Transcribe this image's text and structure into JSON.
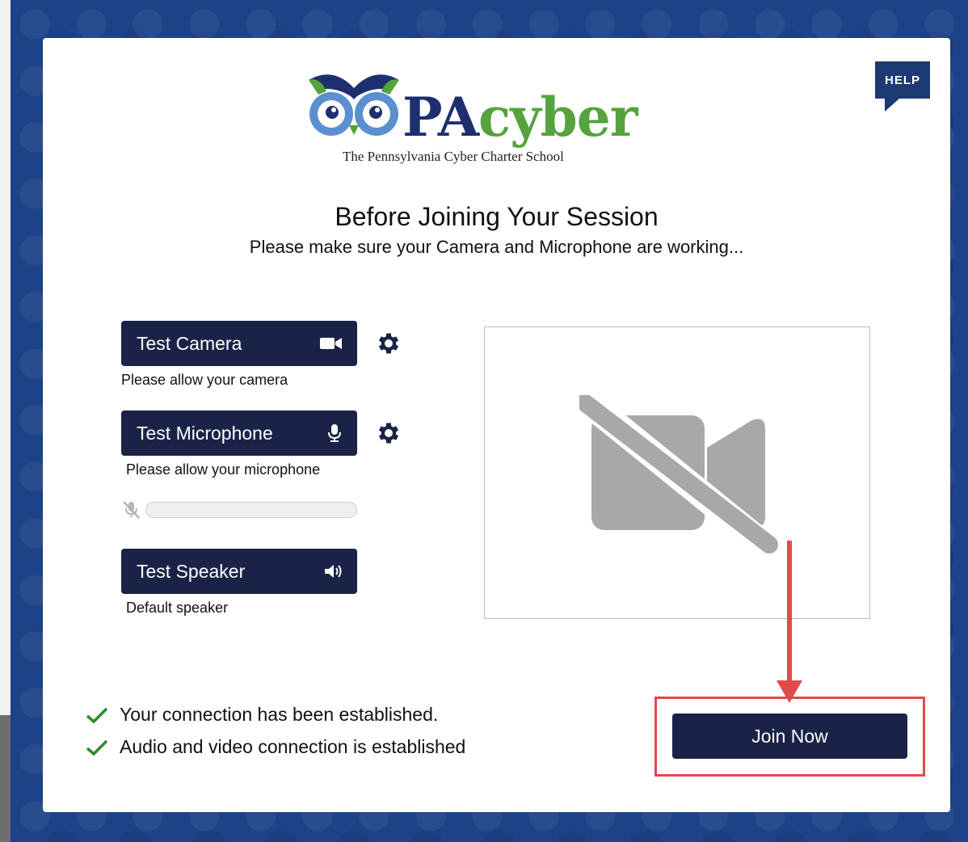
{
  "brand": {
    "name_part1": "PA",
    "name_part2": "cyber",
    "tagline": "The Pennsylvania Cyber Charter School",
    "colors": {
      "navy": "#1d2f6f",
      "green": "#55a33c",
      "owl_blue": "#5b8fcf"
    }
  },
  "help": {
    "label": "HELP"
  },
  "header": {
    "title": "Before Joining Your Session",
    "subtitle": "Please make sure your Camera and Microphone are working..."
  },
  "devices": {
    "camera": {
      "label": "Test Camera",
      "icon": "video-camera-icon",
      "note": "Please allow your camera"
    },
    "microphone": {
      "label": "Test Microphone",
      "icon": "microphone-icon",
      "note": "Please allow your microphone",
      "level": 0
    },
    "speaker": {
      "label": "Test Speaker",
      "icon": "speaker-icon",
      "note": "Default speaker"
    }
  },
  "preview": {
    "icon": "video-off-icon"
  },
  "status": {
    "items": [
      "Your connection has been established.",
      "Audio and video connection is established"
    ]
  },
  "join": {
    "label": "Join Now"
  },
  "colors": {
    "button_bg": "#1a2347",
    "highlight": "#e24a4a",
    "check": "#2e8b2e",
    "page_bg": "#1e4288"
  }
}
